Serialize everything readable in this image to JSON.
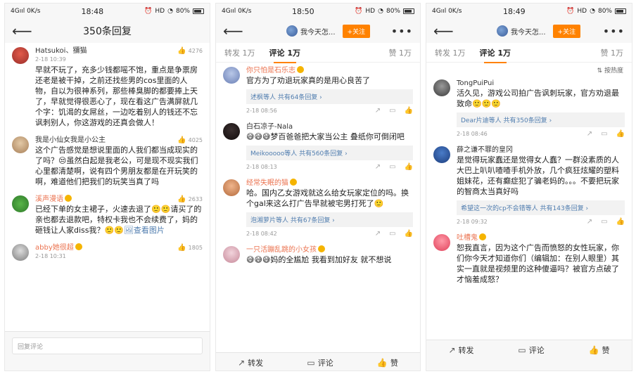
{
  "status": {
    "left": "4Gııl  0K/s",
    "right": "HD",
    "battery": "80%",
    "times": [
      "18:48",
      "18:50",
      "18:49"
    ]
  },
  "screen1": {
    "title": "350条回复",
    "comments": [
      {
        "name": "Hatsukoi、獼猫",
        "date": "2-18 10:39",
        "likes": "4276",
        "text": "早就不玩了，充多少钱都嗂不饱，重点是争票房还老是被干掉，之前还找些男的cos里面的人物，自以为很神系列，那些棒臭脚的都要捧上天了，早就觉得很恶心了，现在看这广告满屏就几个字：饥渴的女屌丝，一边吃着别人的钱还不忘讽刺别人，你这游戏的还真会做人！"
      },
      {
        "name": "我是小仙女我是小公主",
        "date": "2-18 10:40",
        "likes": "4025",
        "text": "这个广告感觉是想说里面的人我们都当成现实的了吗？😒虽然白起是我老公，可是现不现实我们心里都清楚啊，说有四个男朋友都是在开玩笑的啊，难道他们把我们的玩笑当真了吗"
      },
      {
        "name": "溪声漫语",
        "date": "2-18 10:35",
        "likes": "2633",
        "text": "已经下单的女主裙子，火速去退了🙂🙂请买了的亲也都去退款吧，特权卡我也不会续费了，妈的砸钱让人家diss我？🙂🙂",
        "link": "查看图片"
      },
      {
        "name": "abby她很超",
        "date": "2-18 10:31",
        "likes": "1805",
        "text": ""
      }
    ],
    "input_placeholder": "回复评论"
  },
  "screen2": {
    "user": "我今天怎...",
    "follow": "+关注",
    "tabs": {
      "repost": "转发 1万",
      "comment": "评论 1万",
      "like": "赞 1万"
    },
    "comments": [
      {
        "name": "你只怕是石乐志",
        "text": "官方为了劝退玩家真的是用心良苦了",
        "reply": "述枫等人 共有64条回复 ›",
        "date": "2-18 08:56"
      },
      {
        "name": "白石凉子-Nala",
        "text": "😅😅😅梦百爸爸把大家当公主 叠纸你可倒闭吧",
        "reply": "Meikooooo等人 共有560条回复 ›",
        "date": "2-18 08:13"
      },
      {
        "name": "经常失眠的猫",
        "text": "哈。国内乙女游戏就这么给女玩家定位的吗。换个gal来这么打广告早就被宅男打死了🙂",
        "reply": "泡湘萝片等人 共有67条回复 ›",
        "date": "2-18 08:42"
      },
      {
        "name": "一只活蹦乱跳的小女孩",
        "text": "😅😅😅妈的全尴尬 我看到加好友 就不想说",
        "reply": "",
        "date": ""
      }
    ],
    "actions": {
      "repost": "转发",
      "comment": "评论",
      "like": "赞"
    }
  },
  "screen3": {
    "user": "我今天怎...",
    "follow": "+关注",
    "tabs": {
      "repost": "转发 1万",
      "comment": "评论 1万",
      "like": "赞 1万"
    },
    "sort": "⇅ 按热度",
    "comments": [
      {
        "name": "TongPuiPui",
        "text": "活久见，游戏公司拍广告讽刺玩家，官方劝退最致命🙂🙂🙂",
        "reply": "Dear片迪等人 共有350条回复 ›",
        "date": "2-18 08:46"
      },
      {
        "name": "薛之谦不罪的皇冈",
        "text": "是觉得玩家蠢还是觉得女人蠢？一群没素质的人大巴上叭叭喳喳手机外放，几个疯狂炫耀的塑料姐妹花，还有癫症犯了骗老妈的。。。不要把玩家的智商太当真好吗",
        "reply": "希望这一次的cp不会错等人 共有143条回复 ›",
        "date": "2-18 09:32"
      },
      {
        "name": "吐槽鬼",
        "text": "恕我直言，因为这个广告而愤怒的女性玩家，你们你今天才知道你们（编辑加：在别人眼里）其实一直就是视频里的这种傻逼吗？被官方点破了才恼羞成怒？",
        "reply": "",
        "date": ""
      }
    ],
    "actions": {
      "repost": "转发",
      "comment": "评论",
      "like": "赞"
    }
  }
}
